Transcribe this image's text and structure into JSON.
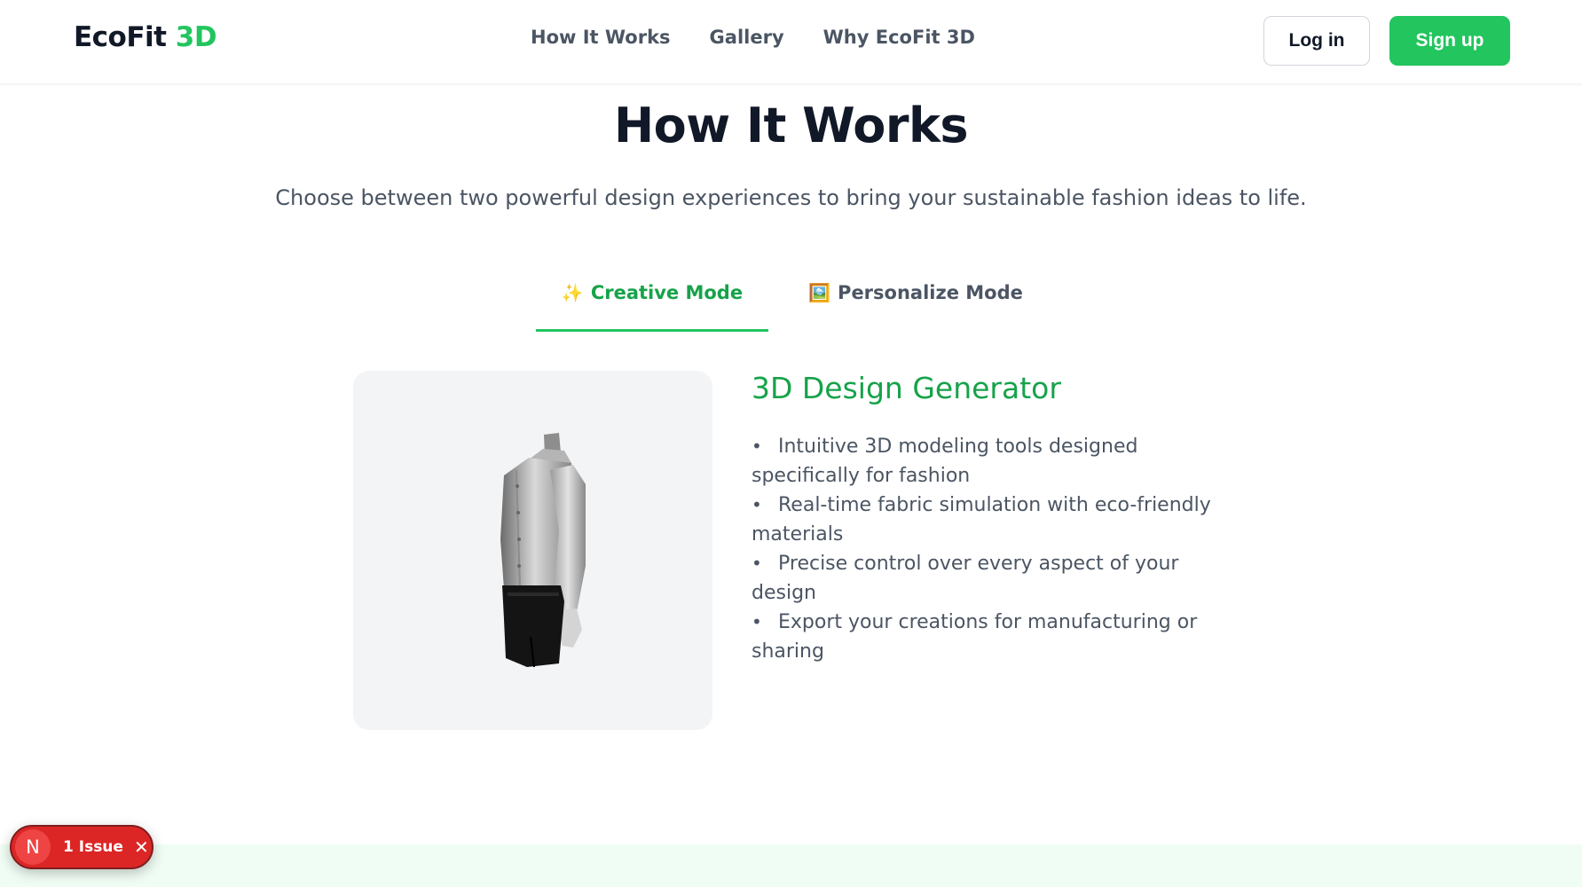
{
  "nav": {
    "logo_main": "EcoFit",
    "logo_accent": "3D",
    "links": [
      "How It Works",
      "Gallery",
      "Why EcoFit 3D"
    ],
    "login_label": "Log in",
    "signup_label": "Sign up"
  },
  "section": {
    "title": "How It Works",
    "subtitle": "Choose between two powerful design experiences to bring your sustainable fashion ideas to life."
  },
  "tabs": [
    {
      "icon": "sparkles-icon",
      "emoji": "✨",
      "label": "Creative Mode",
      "active": true
    },
    {
      "icon": "framed-picture-icon",
      "emoji": "🖼️",
      "label": "Personalize Mode",
      "active": false
    }
  ],
  "panel": {
    "heading": "3D Design Generator",
    "features": [
      "Intuitive 3D modeling tools designed specifically for fashion",
      "Real-time fabric simulation with eco-friendly materials",
      "Precise control over every aspect of your design",
      "Export your creations for manufacturing or sharing"
    ]
  },
  "dev_overlay": {
    "badge_letter": "N",
    "issue_label": "1 Issue",
    "close_symbol": "✕"
  },
  "colors": {
    "accent": "#22c55e",
    "accent_dark": "#16a34a",
    "text_dark": "#111827",
    "text_muted": "#4b5563",
    "issue_red": "#dc2626"
  }
}
